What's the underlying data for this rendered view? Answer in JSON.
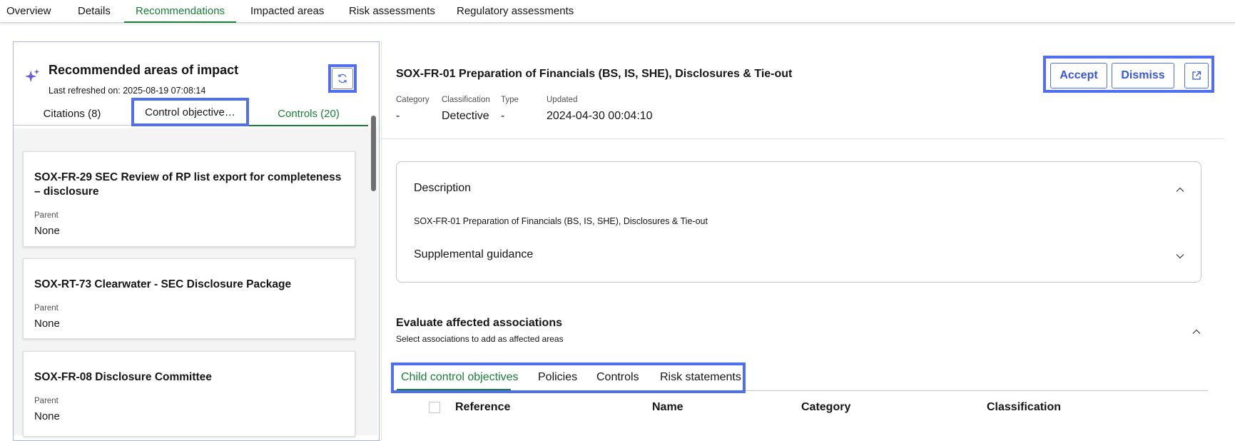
{
  "top_tabs": [
    "Overview",
    "Details",
    "Recommendations",
    "Impacted areas",
    "Risk assessments",
    "Regulatory assessments"
  ],
  "active_top_tab": "Recommendations",
  "recommended": {
    "title": "Recommended areas of impact",
    "last_refreshed": "Last refreshed on: 2025-08-19 07:08:14",
    "tabs": [
      "Citations (8)",
      "Control objective…",
      "Controls (20)"
    ],
    "active_tab": "Controls (20)",
    "cards": [
      {
        "title": "SOX-FR-29 SEC Review of RP list export for completeness – disclosure",
        "parent_label": "Parent",
        "parent": "None"
      },
      {
        "title": "SOX-RT-73 Clearwater - SEC Disclosure Package",
        "parent_label": "Parent",
        "parent": "None"
      },
      {
        "title": "SOX-FR-08 Disclosure Committee",
        "parent_label": "Parent",
        "parent": "None"
      }
    ]
  },
  "detail": {
    "title": "SOX-FR-01 Preparation of Financials (BS, IS, SHE), Disclosures & Tie-out",
    "meta": {
      "category_label": "Category",
      "category": "-",
      "classification_label": "Classification",
      "classification": "Detective",
      "type_label": "Type",
      "type": "-",
      "updated_label": "Updated",
      "updated": "2024-04-30 00:04:10"
    },
    "actions": {
      "accept": "Accept",
      "dismiss": "Dismiss"
    },
    "description_heading": "Description",
    "description_text": "SOX-FR-01 Preparation of Financials (BS, IS, SHE), Disclosures & Tie-out",
    "supplemental_heading": "Supplemental guidance",
    "evaluate_title": "Evaluate affected associations",
    "evaluate_sub": "Select associations to add as affected areas",
    "assoc_tabs": [
      "Child control objectives",
      "Policies",
      "Controls",
      "Risk statements"
    ],
    "table_headers": [
      "Reference",
      "Name",
      "Category",
      "Classification"
    ]
  },
  "colors": {
    "accent_green": "#198038",
    "highlight_blue": "#4f6ff0",
    "button_blue": "#3a56d4"
  }
}
